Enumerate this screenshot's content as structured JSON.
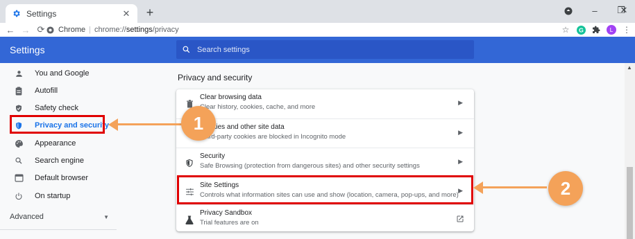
{
  "browser": {
    "tab": {
      "title": "Settings",
      "close_icon": "close-icon"
    },
    "new_tab_label": "+",
    "window_controls": {
      "minimize": "–",
      "maximize": "❐",
      "close": "✕"
    },
    "address": {
      "site_label": "Chrome",
      "separator": "|",
      "url_prefix": "chrome://",
      "url_path": "settings",
      "url_suffix": "/privacy"
    },
    "profile_initial": "L",
    "accent_colors": {
      "grammarly": "#15c39a",
      "profile": "#a142f4"
    }
  },
  "header": {
    "title": "Settings",
    "search_placeholder": "Search settings",
    "background": "#3367d6"
  },
  "sidebar": {
    "items": [
      {
        "label": "You and Google",
        "icon": "person-icon",
        "active": false
      },
      {
        "label": "Autofill",
        "icon": "clipboard-icon",
        "active": false
      },
      {
        "label": "Safety check",
        "icon": "shield-check-icon",
        "active": false
      },
      {
        "label": "Privacy and security",
        "icon": "shield-icon",
        "active": true
      },
      {
        "label": "Appearance",
        "icon": "palette-icon",
        "active": false
      },
      {
        "label": "Search engine",
        "icon": "search-icon",
        "active": false
      },
      {
        "label": "Default browser",
        "icon": "browser-icon",
        "active": false
      },
      {
        "label": "On startup",
        "icon": "power-icon",
        "active": false
      }
    ],
    "advanced_label": "Advanced",
    "active_color": "#1a73e8"
  },
  "main": {
    "section_title": "Privacy and security",
    "rows": [
      {
        "title": "Clear browsing data",
        "subtitle": "Clear history, cookies, cache, and more",
        "icon": "trash-icon",
        "trailing": "chevron"
      },
      {
        "title": "Cookies and other site data",
        "subtitle": "Third-party cookies are blocked in Incognito mode",
        "icon": "cookie-icon",
        "trailing": "chevron"
      },
      {
        "title": "Security",
        "subtitle": "Safe Browsing (protection from dangerous sites) and other security settings",
        "icon": "shield-icon",
        "trailing": "chevron"
      },
      {
        "title": "Site Settings",
        "subtitle": "Controls what information sites can use and show (location, camera, pop-ups, and more)",
        "icon": "sliders-icon",
        "trailing": "chevron"
      },
      {
        "title": "Privacy Sandbox",
        "subtitle": "Trial features are on",
        "icon": "flask-icon",
        "trailing": "external-link"
      }
    ]
  },
  "annotations": {
    "badge_1": "1",
    "badge_2": "2",
    "highlight_color": "#e00000",
    "callout_color": "#f4a259"
  }
}
